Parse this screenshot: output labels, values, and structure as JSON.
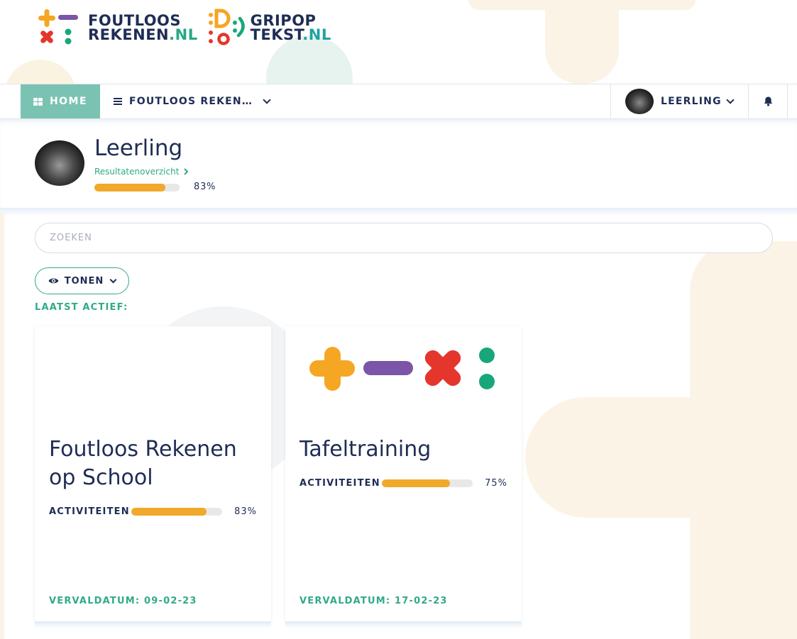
{
  "logos": {
    "logo1": {
      "line1": "FOUTLOOS",
      "line2_main": "REKENEN",
      "line2_suffix": ".NL"
    },
    "logo2": {
      "line1": "GRIPOP",
      "line2_main": "TEKST",
      "line2_suffix": ".NL"
    }
  },
  "nav": {
    "home_label": "HOME",
    "course_label": "FOUTLOOS REKEN…",
    "user_label": "LEERLING"
  },
  "profile": {
    "name": "Leerling",
    "results_link": "Resultatenoverzicht",
    "progress": 0.83,
    "progress_label": "83%"
  },
  "search": {
    "placeholder": "ZOEKEN"
  },
  "filter": {
    "show_label": "TONEN"
  },
  "section": {
    "last_active_label": "LAATST ACTIEF:"
  },
  "cards": [
    {
      "title": "Foutloos Rekenen op School",
      "activities_label": "ACTIVITEITEN",
      "progress": 0.83,
      "progress_label": "83%",
      "due": "VERVALDATUM: 09-02-23"
    },
    {
      "title": "Tafeltraining",
      "activities_label": "ACTIVITEITEN",
      "progress": 0.75,
      "progress_label": "75%",
      "due": "VERVALDATUM: 17-02-23"
    }
  ],
  "colors": {
    "brand_navy": "#1f2d55",
    "brand_green": "#30aa88",
    "home_tab": "#7ac3b3",
    "progress_orange": "#f0a92a",
    "icon_orange": "#f5a623",
    "icon_purple": "#7b55a8",
    "icon_red": "#e5362d",
    "icon_green": "#18a77a"
  },
  "icons": {
    "home": "grid-icon",
    "course": "bars-icon",
    "dropdown": "chevron-down-icon",
    "bell": "bell-icon",
    "results": "chevron-right-icon",
    "show": "eye-icon"
  }
}
